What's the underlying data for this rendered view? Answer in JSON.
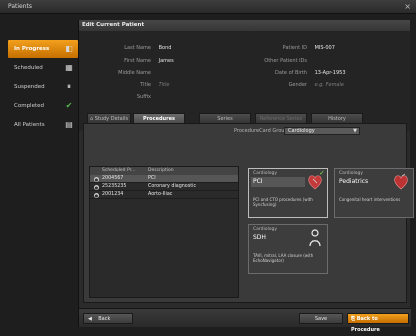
{
  "window": {
    "title": "Patients",
    "close_glyph": "×"
  },
  "sidebar": {
    "items": [
      {
        "label": "In Progress",
        "icon": "clipboard-icon",
        "glyph": "◧"
      },
      {
        "label": "Scheduled",
        "icon": "calendar-icon",
        "glyph": "▦"
      },
      {
        "label": "Suspended",
        "icon": "pause-icon",
        "glyph": "⏸"
      },
      {
        "label": "Completed",
        "icon": "check-icon",
        "glyph": "✔"
      },
      {
        "label": "All Patients",
        "icon": "list-icon",
        "glyph": "▤"
      }
    ]
  },
  "panel": {
    "title": "Edit Current Patient"
  },
  "form": {
    "last_name_label": "Last Name",
    "last_name": "Bond",
    "first_name_label": "First Name",
    "first_name": "James",
    "middle_name_label": "Middle Name",
    "middle_name": "",
    "title_label": "Title",
    "title_placeholder": "Title",
    "suffix_label": "Suffix",
    "suffix": "",
    "patient_id_label": "Patient ID",
    "patient_id": "MIS-007",
    "other_ids_label": "Other Patient IDs",
    "other_ids": "",
    "dob_label": "Date of Birth",
    "dob": "13-Apr-1953",
    "gender_label": "Gender",
    "gender_placeholder": "e.g. Female"
  },
  "tabs": [
    {
      "label": "Study Details"
    },
    {
      "label": "Procedures"
    },
    {
      "label": "Series"
    },
    {
      "label": "Reference Series"
    },
    {
      "label": "History"
    }
  ],
  "procedure_group": {
    "label": "ProcedureCard Group",
    "value": "Cardiology",
    "arrow": "▼"
  },
  "table": {
    "headers": [
      "Scheduled Pr...",
      "Description"
    ],
    "rows": [
      {
        "id": "2004567",
        "description": "PCI"
      },
      {
        "id": "25235235",
        "description": "Coronary diagnostic"
      },
      {
        "id": "2001234",
        "description": "Aorto-Iliac"
      }
    ]
  },
  "cards": [
    {
      "category": "Cardiology",
      "name": "PCI",
      "description": "PCI and CTO procedures (with Syncfusing)"
    },
    {
      "category": "Cardiology",
      "name": "Pediatrics",
      "description": "Congenital heart interventions"
    },
    {
      "category": "Cardiology",
      "name": "SDH",
      "description": "TAVI, mitral, LAA closure (with EchoNavigator)"
    }
  ],
  "footer": {
    "back": "Back",
    "save": "Save",
    "back_to_procedure": "Back to Procedure"
  },
  "colors": {
    "accent": "#e58a10",
    "check": "#7ed957"
  }
}
